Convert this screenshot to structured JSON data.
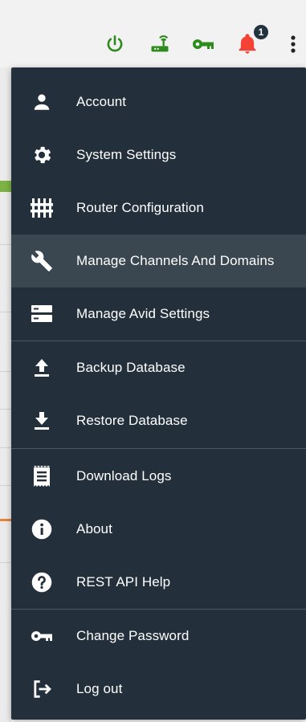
{
  "topbar": {
    "icons": [
      "power-icon",
      "router-icon",
      "key-icon",
      "notification-bell-icon",
      "more-vert-icon"
    ],
    "notification_count": "1",
    "colors": {
      "green": "#2e8b1e",
      "bell": "#f44336",
      "badge": "#213240"
    }
  },
  "menu": {
    "items": [
      {
        "label": "Account",
        "icon": "account-icon"
      },
      {
        "label": "System Settings",
        "icon": "gear-icon"
      },
      {
        "label": "Router Configuration",
        "icon": "router-config-icon"
      },
      {
        "label": "Manage Channels And Domains",
        "icon": "wrench-icon",
        "active": true
      },
      {
        "label": "Manage Avid Settings",
        "icon": "storage-icon"
      },
      {
        "label": "Backup Database",
        "icon": "upload-icon"
      },
      {
        "label": "Restore Database",
        "icon": "download-icon"
      },
      {
        "label": "Download Logs",
        "icon": "logs-icon"
      },
      {
        "label": "About",
        "icon": "info-icon"
      },
      {
        "label": "REST API Help",
        "icon": "help-icon"
      },
      {
        "label": "Change Password",
        "icon": "key-icon"
      },
      {
        "label": "Log out",
        "icon": "logout-icon"
      }
    ],
    "colors": {
      "background": "#23303b",
      "active": "#3a4650",
      "text": "#ffffff",
      "divider": "#4c5862"
    }
  }
}
